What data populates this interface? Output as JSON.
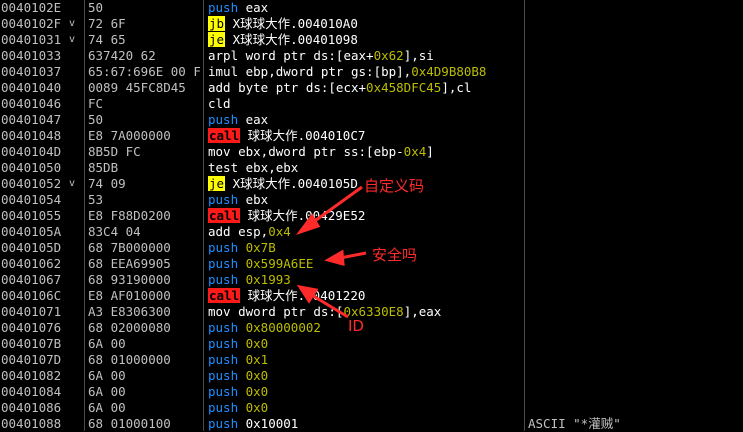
{
  "rows": [
    {
      "addr": "0040102E",
      "mark": "",
      "hex": "50",
      "tokens": [
        {
          "t": "push",
          "c": "push"
        },
        {
          "t": " eax",
          "c": "plain"
        }
      ],
      "comment": ""
    },
    {
      "addr": "0040102F",
      "mark": "v",
      "hex": "72 6F",
      "tokens": [
        {
          "t": "jb",
          "c": "jx"
        },
        {
          "t": " X球球大作.004010A0",
          "c": "plain"
        }
      ],
      "comment": ""
    },
    {
      "addr": "00401031",
      "mark": "v",
      "hex": "74 65",
      "tokens": [
        {
          "t": "je",
          "c": "jx"
        },
        {
          "t": " X球球大作.00401098",
          "c": "plain"
        }
      ],
      "comment": ""
    },
    {
      "addr": "00401033",
      "mark": "",
      "hex": "637420 62",
      "tokens": [
        {
          "t": "arpl word ptr ds:[eax+",
          "c": "mn"
        },
        {
          "t": "0x62",
          "c": "num"
        },
        {
          "t": "],si",
          "c": "mn"
        }
      ],
      "comment": ""
    },
    {
      "addr": "00401037",
      "mark": "",
      "hex": "65:67:696E 00 F",
      "tokens": [
        {
          "t": "imul ebp,dword ptr gs:[bp],",
          "c": "mn"
        },
        {
          "t": "0x4D9B80B8",
          "c": "num"
        }
      ],
      "comment": ""
    },
    {
      "addr": "00401040",
      "mark": "",
      "hex": "0089 45FC8D45",
      "tokens": [
        {
          "t": "add byte ptr ds:[ecx+",
          "c": "mn"
        },
        {
          "t": "0x458DFC45",
          "c": "num"
        },
        {
          "t": "],cl",
          "c": "mn"
        }
      ],
      "comment": ""
    },
    {
      "addr": "00401046",
      "mark": "",
      "hex": "FC",
      "tokens": [
        {
          "t": "cld",
          "c": "mn"
        }
      ],
      "comment": ""
    },
    {
      "addr": "00401047",
      "mark": "",
      "hex": "50",
      "tokens": [
        {
          "t": "push",
          "c": "push"
        },
        {
          "t": " eax",
          "c": "plain"
        }
      ],
      "comment": ""
    },
    {
      "addr": "00401048",
      "mark": "",
      "hex": "E8 7A000000",
      "tokens": [
        {
          "t": "call",
          "c": "call"
        },
        {
          "t": " 球球大作.004010C7",
          "c": "plain"
        }
      ],
      "comment": ""
    },
    {
      "addr": "0040104D",
      "mark": "",
      "hex": "8B5D FC",
      "tokens": [
        {
          "t": "mov ebx,dword ptr ss:[ebp-",
          "c": "mn"
        },
        {
          "t": "0x4",
          "c": "num"
        },
        {
          "t": "]",
          "c": "mn"
        }
      ],
      "comment": ""
    },
    {
      "addr": "00401050",
      "mark": "",
      "hex": "85DB",
      "tokens": [
        {
          "t": "test ebx,ebx",
          "c": "mn"
        }
      ],
      "comment": ""
    },
    {
      "addr": "00401052",
      "mark": "v",
      "hex": "74 09",
      "tokens": [
        {
          "t": "je",
          "c": "jx"
        },
        {
          "t": " X球球大作.0040105D",
          "c": "plain"
        }
      ],
      "comment": ""
    },
    {
      "addr": "00401054",
      "mark": "",
      "hex": "53",
      "tokens": [
        {
          "t": "push",
          "c": "push"
        },
        {
          "t": " ebx",
          "c": "plain"
        }
      ],
      "comment": ""
    },
    {
      "addr": "00401055",
      "mark": "",
      "hex": "E8 F88D0200",
      "tokens": [
        {
          "t": "call",
          "c": "call"
        },
        {
          "t": " 球球大作.00429E52",
          "c": "plain"
        }
      ],
      "comment": ""
    },
    {
      "addr": "0040105A",
      "mark": "",
      "hex": "83C4 04",
      "tokens": [
        {
          "t": "add esp,",
          "c": "mn"
        },
        {
          "t": "0x4",
          "c": "num"
        }
      ],
      "comment": ""
    },
    {
      "addr": "0040105D",
      "mark": "",
      "hex": "68 7B000000",
      "tokens": [
        {
          "t": "push",
          "c": "push"
        },
        {
          "t": " 0x7B",
          "c": "dim"
        }
      ],
      "comment": ""
    },
    {
      "addr": "00401062",
      "mark": "",
      "hex": "68 EEA69905",
      "tokens": [
        {
          "t": "push",
          "c": "push"
        },
        {
          "t": " 0x599A6EE",
          "c": "dim"
        }
      ],
      "comment": ""
    },
    {
      "addr": "00401067",
      "mark": "",
      "hex": "68 93190000",
      "tokens": [
        {
          "t": "push",
          "c": "push"
        },
        {
          "t": " 0x1993",
          "c": "dim"
        }
      ],
      "comment": ""
    },
    {
      "addr": "0040106C",
      "mark": "",
      "hex": "E8 AF010000",
      "tokens": [
        {
          "t": "call",
          "c": "call"
        },
        {
          "t": " 球球大作.00401220",
          "c": "plain"
        }
      ],
      "comment": ""
    },
    {
      "addr": "00401071",
      "mark": "",
      "hex": "A3 E8306300",
      "tokens": [
        {
          "t": "mov dword ptr ds:[",
          "c": "mn"
        },
        {
          "t": "0x6330E8",
          "c": "num"
        },
        {
          "t": "],eax",
          "c": "mn"
        }
      ],
      "comment": ""
    },
    {
      "addr": "00401076",
      "mark": "",
      "hex": "68 02000080",
      "tokens": [
        {
          "t": "push",
          "c": "push"
        },
        {
          "t": " 0x80000002",
          "c": "dim"
        }
      ],
      "comment": ""
    },
    {
      "addr": "0040107B",
      "mark": "",
      "hex": "6A 00",
      "tokens": [
        {
          "t": "push",
          "c": "push"
        },
        {
          "t": " 0x0",
          "c": "dim"
        }
      ],
      "comment": ""
    },
    {
      "addr": "0040107D",
      "mark": "",
      "hex": "68 01000000",
      "tokens": [
        {
          "t": "push",
          "c": "push"
        },
        {
          "t": " 0x1",
          "c": "dim"
        }
      ],
      "comment": ""
    },
    {
      "addr": "00401082",
      "mark": "",
      "hex": "6A 00",
      "tokens": [
        {
          "t": "push",
          "c": "push"
        },
        {
          "t": " 0x0",
          "c": "dim"
        }
      ],
      "comment": ""
    },
    {
      "addr": "00401084",
      "mark": "",
      "hex": "6A 00",
      "tokens": [
        {
          "t": "push",
          "c": "push"
        },
        {
          "t": " 0x0",
          "c": "dim"
        }
      ],
      "comment": ""
    },
    {
      "addr": "00401086",
      "mark": "",
      "hex": "6A 00",
      "tokens": [
        {
          "t": "push",
          "c": "push"
        },
        {
          "t": " 0x0",
          "c": "dim"
        }
      ],
      "comment": ""
    },
    {
      "addr": "00401088",
      "mark": "",
      "hex": "68 01000100",
      "tokens": [
        {
          "t": "push",
          "c": "push"
        },
        {
          "t": " 0x10001",
          "c": "plain"
        }
      ],
      "comment": "ASCII \"*灌贼\""
    }
  ],
  "annotations": {
    "custom_code": "自定义码",
    "safe": "安全吗",
    "id": "ID"
  },
  "colors": {
    "background": "#000000",
    "push": "#1e90ff",
    "jump_highlight": "#ffff00",
    "call_highlight": "#ff1a1a",
    "annotation": "#ff2a2a"
  }
}
